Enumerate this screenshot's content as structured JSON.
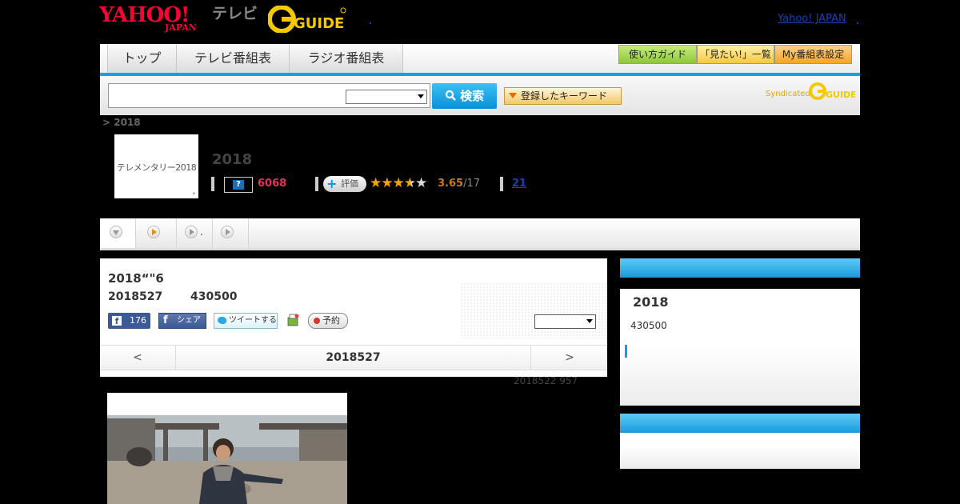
{
  "header": {
    "yahoo_logo": "YAHOO!",
    "yahoo_sub": "JAPAN",
    "tv_label": "テレビ",
    "gguide_logo": "G-GUIDE",
    "yahoo_japan_link": "Yahoo! JAPAN"
  },
  "nav": {
    "tabs": [
      {
        "label": "トップ"
      },
      {
        "label": "テレビ番組表"
      },
      {
        "label": "ラジオ番組表"
      }
    ],
    "buttons": [
      {
        "label": "使い方ガイド",
        "color": "#8dc63f"
      },
      {
        "label": "「見たい!」一覧",
        "color": "#f5c842"
      },
      {
        "label": "My番組表設定",
        "color": "#f5a623"
      }
    ],
    "accent": "#1aa0dc"
  },
  "search": {
    "input_value": "",
    "select_value": "",
    "button_label": "検索",
    "keyword_label": "登録したキーワード",
    "syndicated_label": "Syndicated"
  },
  "breadcrumb": "> 2018",
  "program": {
    "thumb_text": "テレメンタリー2018",
    "title": "2018",
    "count": "6068",
    "rate_label": "評価",
    "rating": 3.65,
    "score": "3.65",
    "score_den": "/17",
    "link": "21"
  },
  "subnav": {
    "items": [
      {
        "label": ""
      },
      {
        "label": "."
      },
      {
        "label": ""
      },
      {
        "label": ""
      }
    ]
  },
  "episode": {
    "title": "2018“\"6",
    "date": "2018527",
    "time": "430500",
    "fb_count": "176",
    "fb_share": "シェア",
    "tweet": "ツイートする",
    "record": "予約",
    "select_value": "",
    "pager_prev": "<",
    "pager_date": "2018527",
    "pager_next": ">"
  },
  "update_text": "2018522  957",
  "side": {
    "title": "2018",
    "time": "430500"
  }
}
